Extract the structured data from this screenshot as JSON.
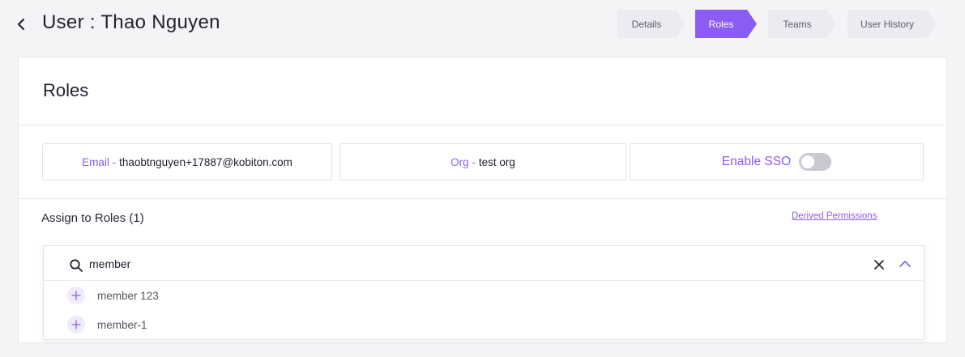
{
  "header": {
    "title": "User : Thao Nguyen"
  },
  "steps": [
    {
      "label": "Details",
      "active": false
    },
    {
      "label": "Roles",
      "active": true
    },
    {
      "label": "Teams",
      "active": false
    },
    {
      "label": "User History",
      "active": false
    }
  ],
  "card": {
    "title": "Roles",
    "email_label": "Email -",
    "email_value": "thaobtnguyen+17887@kobiton.com",
    "org_label": "Org -",
    "org_value": "test org",
    "sso_label": "Enable SSO",
    "sso_enabled": false,
    "assign_label": "Assign to Roles (1)",
    "derived_link": "Derived Permissions"
  },
  "search": {
    "value": "member",
    "options": [
      "member 123",
      "member-1"
    ]
  },
  "colors": {
    "accent": "#8b5cf6",
    "step_inactive": "#ebebf1"
  }
}
